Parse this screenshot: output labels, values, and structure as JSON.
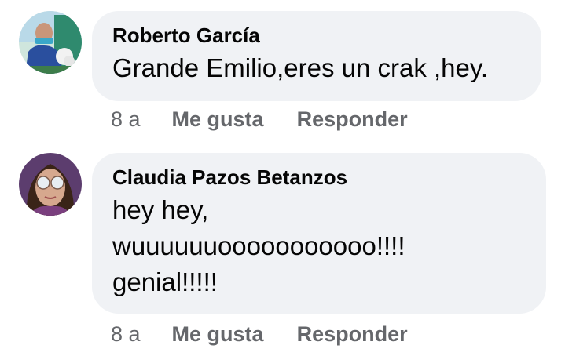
{
  "comments": [
    {
      "author": "Roberto García",
      "text_lines": [
        "Grande Emilio,eres un crak ,hey."
      ],
      "time": "8 a",
      "like_label": "Me gusta",
      "reply_label": "Responder",
      "avatar_icon": "user-avatar-photo"
    },
    {
      "author": "Claudia Pazos Betanzos",
      "text_lines": [
        "hey hey,",
        "wuuuuuuooooooooooo!!!!",
        "genial!!!!!"
      ],
      "time": "8 a",
      "like_label": "Me gusta",
      "reply_label": "Responder",
      "avatar_icon": "user-avatar-photo"
    }
  ],
  "colors": {
    "bubble": "#f0f2f5",
    "text": "#050505",
    "secondary": "#65676b"
  }
}
